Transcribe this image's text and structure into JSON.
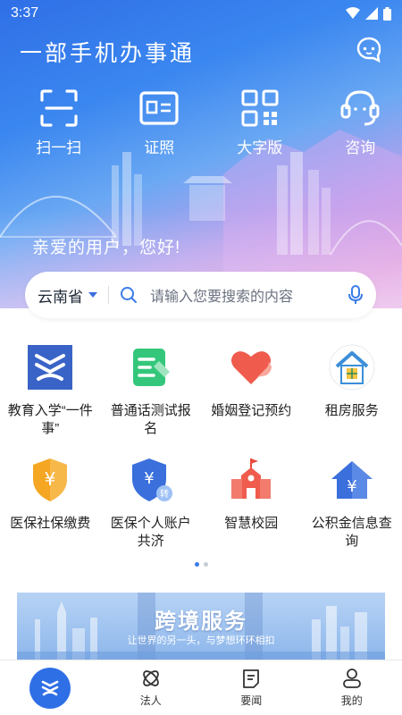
{
  "status_bar": {
    "time": "3:37"
  },
  "header": {
    "title": "一部手机办事通",
    "chat_icon": "chat-bubble-icon"
  },
  "quick_actions": [
    {
      "label": "扫一扫",
      "icon": "scan-icon"
    },
    {
      "label": "证照",
      "icon": "id-card-icon"
    },
    {
      "label": "大字版",
      "icon": "large-text-icon"
    },
    {
      "label": "咨询",
      "icon": "headset-icon"
    }
  ],
  "greeting": "亲爱的用户，您好!",
  "search": {
    "province": "云南省",
    "placeholder": "请输入您要搜索的内容"
  },
  "services": [
    {
      "label": "教育入学“一件事”",
      "icon": "education-icon"
    },
    {
      "label": "普通话测试报名",
      "icon": "test-signup-icon"
    },
    {
      "label": "婚姻登记预约",
      "icon": "heart-icon"
    },
    {
      "label": "租房服务",
      "icon": "house-icon"
    },
    {
      "label": "医保社保缴费",
      "icon": "shield-yuan-icon"
    },
    {
      "label": "医保个人账户共济",
      "icon": "shield-transfer-icon"
    },
    {
      "label": "智慧校园",
      "icon": "school-icon"
    },
    {
      "label": "公积金信息查询",
      "icon": "house-yuan-icon"
    }
  ],
  "pager": {
    "pages": 2,
    "active": 1
  },
  "banner": {
    "title": "跨境服务",
    "subtitle": "让世界的另一头，与梦想环环相扣"
  },
  "bottom_nav": [
    {
      "label": "",
      "icon": "home-logo-icon",
      "active": true
    },
    {
      "label": "法人",
      "icon": "legal-person-icon"
    },
    {
      "label": "要闻",
      "icon": "news-icon"
    },
    {
      "label": "我的",
      "icon": "profile-icon"
    }
  ],
  "colors": {
    "primary": "#2f6fe6",
    "accent_red": "#ef5b4c",
    "accent_orange": "#f5a623",
    "accent_green": "#34c77b"
  }
}
